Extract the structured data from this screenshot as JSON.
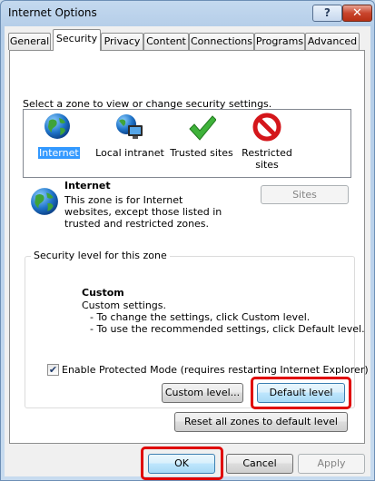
{
  "window": {
    "title": "Internet Options"
  },
  "tabs": [
    "General",
    "Security",
    "Privacy",
    "Content",
    "Connections",
    "Programs",
    "Advanced"
  ],
  "security": {
    "zone_prompt": "Select a zone to view or change security settings.",
    "zones": [
      {
        "label": "Internet",
        "icon": "globe-icon"
      },
      {
        "label": "Local intranet",
        "icon": "intranet-icon"
      },
      {
        "label": "Trusted sites",
        "icon": "checkmark-icon"
      },
      {
        "label": "Restricted sites",
        "icon": "restricted-icon"
      }
    ],
    "selected_zone": {
      "name": "Internet",
      "description": "This zone is for Internet websites, except those listed in trusted and restricted zones."
    },
    "sites_label": "Sites",
    "level_group_title": "Security level for this zone",
    "level_name": "Custom",
    "level_desc": [
      "Custom settings.",
      "- To change the settings, click Custom level.",
      "- To use the recommended settings, click Default level."
    ],
    "protected_mode_label": "Enable Protected Mode (requires restarting Internet Explorer)",
    "protected_mode_checked": true,
    "custom_level_label": "Custom level...",
    "default_level_label": "Default level",
    "reset_all_label": "Reset all zones to default level"
  },
  "footer": {
    "ok_label": "OK",
    "cancel_label": "Cancel",
    "apply_label": "Apply"
  },
  "highlight_color": "#e00000"
}
